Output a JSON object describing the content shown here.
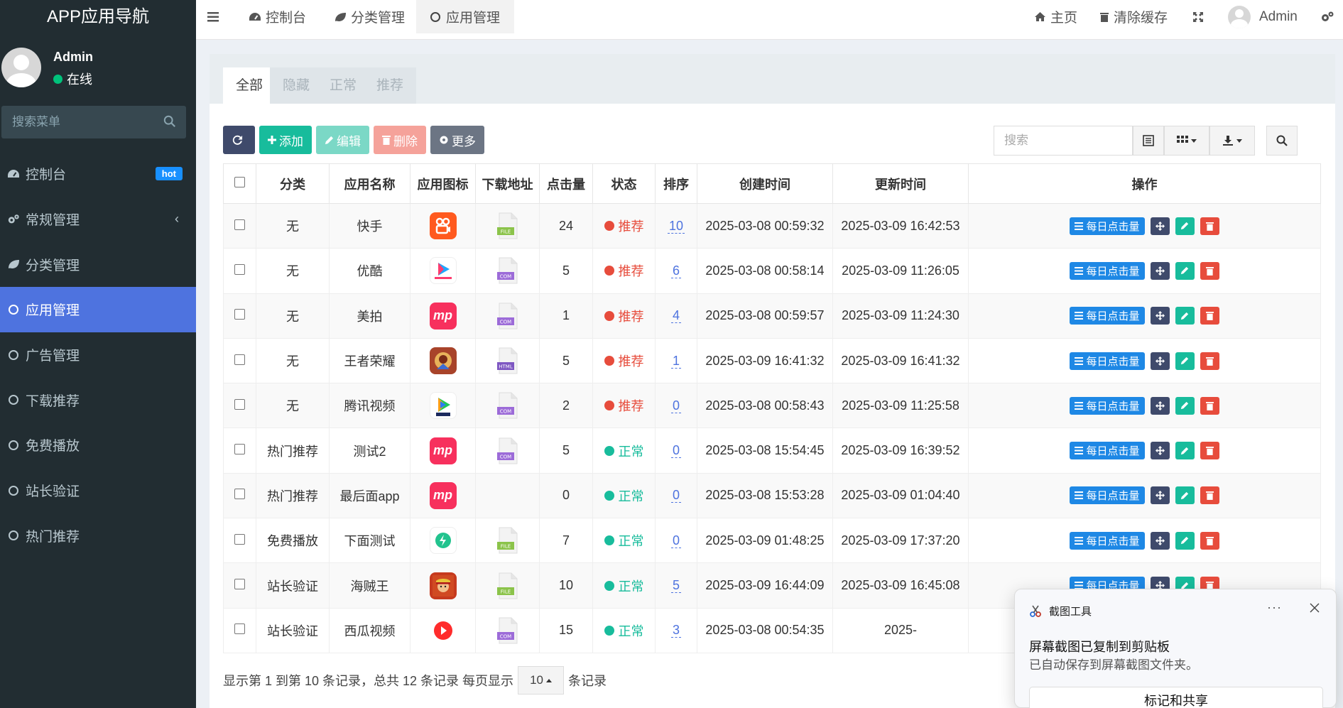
{
  "app": {
    "title": "APP应用导航"
  },
  "user": {
    "name": "Admin",
    "status": "在线"
  },
  "sidebar": {
    "search_placeholder": "搜索菜单",
    "items": [
      {
        "label": "控制台",
        "icon": "dashboard-icon",
        "badge": "hot"
      },
      {
        "label": "常规管理",
        "icon": "cogs-icon",
        "chevron": "‹"
      },
      {
        "label": "分类管理",
        "icon": "leaf-icon"
      },
      {
        "label": "应用管理",
        "icon": "circle-icon",
        "active": true
      },
      {
        "label": "广告管理",
        "icon": "circle-icon"
      },
      {
        "label": "下载推荐",
        "icon": "circle-icon"
      },
      {
        "label": "免费播放",
        "icon": "circle-icon"
      },
      {
        "label": "站长验证",
        "icon": "circle-icon"
      },
      {
        "label": "热门推荐",
        "icon": "circle-icon"
      }
    ]
  },
  "header": {
    "tabs": [
      {
        "label": "控制台",
        "icon": "dashboard-icon"
      },
      {
        "label": "分类管理",
        "icon": "leaf-icon"
      },
      {
        "label": "应用管理",
        "icon": "circle-icon",
        "active": true
      }
    ],
    "home": "主页",
    "clear_cache": "清除缓存",
    "user": "Admin"
  },
  "filter_tabs": [
    "全部",
    "隐藏",
    "正常",
    "推荐"
  ],
  "toolbar": {
    "add": "添加",
    "edit": "编辑",
    "delete": "删除",
    "more": "更多",
    "search_placeholder": "搜索"
  },
  "table": {
    "columns": [
      "分类",
      "应用名称",
      "应用图标",
      "下载地址",
      "点击量",
      "状态",
      "排序",
      "创建时间",
      "更新时间",
      "操作"
    ],
    "rows": [
      {
        "category": "无",
        "name": "快手",
        "icon": "kuaishou",
        "file": "FILE",
        "clicks": "24",
        "status": "推荐",
        "sort": "10",
        "created": "2025-03-08 00:59:32",
        "updated": "2025-03-09 16:42:53"
      },
      {
        "category": "无",
        "name": "优酷",
        "icon": "youku",
        "file": "COM",
        "clicks": "5",
        "status": "推荐",
        "sort": "6",
        "created": "2025-03-08 00:58:14",
        "updated": "2025-03-09 11:26:05"
      },
      {
        "category": "无",
        "name": "美拍",
        "icon": "meipai",
        "file": "COM",
        "clicks": "1",
        "status": "推荐",
        "sort": "4",
        "created": "2025-03-08 00:59:57",
        "updated": "2025-03-09 11:24:30"
      },
      {
        "category": "无",
        "name": "王者荣耀",
        "icon": "wangzhe",
        "file": "HTML",
        "clicks": "5",
        "status": "推荐",
        "sort": "1",
        "created": "2025-03-09 16:41:32",
        "updated": "2025-03-09 16:41:32"
      },
      {
        "category": "无",
        "name": "腾讯视频",
        "icon": "tencent",
        "file": "COM",
        "clicks": "2",
        "status": "推荐",
        "sort": "0",
        "created": "2025-03-08 00:58:43",
        "updated": "2025-03-09 11:25:58"
      },
      {
        "category": "热门推荐",
        "name": "测试2",
        "icon": "meipai",
        "file": "COM",
        "clicks": "5",
        "status": "正常",
        "sort": "0",
        "created": "2025-03-08 15:54:45",
        "updated": "2025-03-09 16:39:52"
      },
      {
        "category": "热门推荐",
        "name": "最后面app",
        "icon": "meipai",
        "file": "",
        "clicks": "0",
        "status": "正常",
        "sort": "0",
        "created": "2025-03-08 15:53:28",
        "updated": "2025-03-09 01:04:40"
      },
      {
        "category": "免费播放",
        "name": "下面测试",
        "icon": "flash",
        "file": "FILE",
        "clicks": "7",
        "status": "正常",
        "sort": "0",
        "created": "2025-03-09 01:48:25",
        "updated": "2025-03-09 17:37:20"
      },
      {
        "category": "站长验证",
        "name": "海贼王",
        "icon": "onepiece",
        "file": "FILE",
        "clicks": "10",
        "status": "正常",
        "sort": "5",
        "created": "2025-03-09 16:44:09",
        "updated": "2025-03-09 16:45:08"
      },
      {
        "category": "站长验证",
        "name": "西瓜视频",
        "icon": "xigua",
        "file": "COM",
        "clicks": "15",
        "status": "正常",
        "sort": "3",
        "created": "2025-03-08 00:54:35",
        "updated": "2025-"
      }
    ],
    "op_daily": "每日点击量"
  },
  "pager": {
    "pre": "显示第 1 到第 10 条记录，总共 12 条记录 每页显示",
    "size": "10",
    "post": "条记录"
  },
  "toast": {
    "app": "截图工具",
    "dots": "···",
    "title": "屏幕截图已复制到剪贴板",
    "message": "已自动保存到屏幕截图文件夹。",
    "button": "标记和共享"
  },
  "colors": {
    "sidebar": "#222d32",
    "accent": "#4e73df",
    "recommend": "#e74c3c",
    "normal": "#18bc9c",
    "green_btn": "#18bc9c"
  }
}
